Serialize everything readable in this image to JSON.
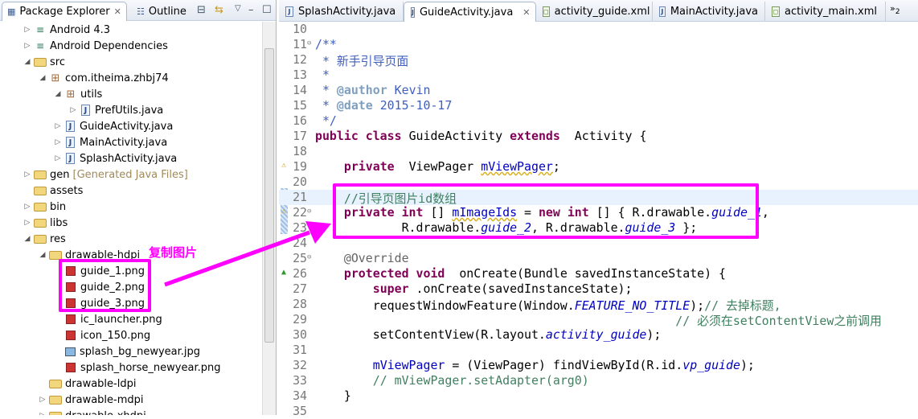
{
  "left_tabs": {
    "package_explorer": "Package Explorer",
    "outline": "Outline"
  },
  "tree": [
    {
      "label": "Android 4.3",
      "level": 0,
      "toggle": "collapsed",
      "icon": "lib"
    },
    {
      "label": "Android Dependencies",
      "level": 0,
      "toggle": "collapsed",
      "icon": "lib"
    },
    {
      "label": "src",
      "level": 0,
      "toggle": "expanded",
      "icon": "folder"
    },
    {
      "label": "com.itheima.zhbj74",
      "level": 1,
      "toggle": "expanded",
      "icon": "pkg"
    },
    {
      "label": "utils",
      "level": 2,
      "toggle": "expanded",
      "icon": "pkg"
    },
    {
      "label": "PrefUtils.java",
      "level": 3,
      "toggle": "collapsed",
      "icon": "java"
    },
    {
      "label": "GuideActivity.java",
      "level": 2,
      "toggle": "collapsed",
      "icon": "java"
    },
    {
      "label": "MainActivity.java",
      "level": 2,
      "toggle": "collapsed",
      "icon": "java"
    },
    {
      "label": "SplashActivity.java",
      "level": 2,
      "toggle": "collapsed",
      "icon": "java"
    },
    {
      "label": "gen",
      "decor": "[Generated Java Files]",
      "level": 0,
      "toggle": "collapsed",
      "icon": "folder"
    },
    {
      "label": "assets",
      "level": 0,
      "toggle": "none",
      "icon": "folder"
    },
    {
      "label": "bin",
      "level": 0,
      "toggle": "collapsed",
      "icon": "folder"
    },
    {
      "label": "libs",
      "level": 0,
      "toggle": "collapsed",
      "icon": "folder"
    },
    {
      "label": "res",
      "level": 0,
      "toggle": "expanded",
      "icon": "folder"
    },
    {
      "label": "drawable-hdpi",
      "level": 1,
      "toggle": "expanded",
      "icon": "folder"
    },
    {
      "label": "guide_1.png",
      "level": 2,
      "toggle": "none",
      "icon": "png"
    },
    {
      "label": "guide_2.png",
      "level": 2,
      "toggle": "none",
      "icon": "png"
    },
    {
      "label": "guide_3.png",
      "level": 2,
      "toggle": "none",
      "icon": "png"
    },
    {
      "label": "ic_launcher.png",
      "level": 2,
      "toggle": "none",
      "icon": "png"
    },
    {
      "label": "icon_150.png",
      "level": 2,
      "toggle": "none",
      "icon": "png"
    },
    {
      "label": "splash_bg_newyear.jpg",
      "level": 2,
      "toggle": "none",
      "icon": "jpg"
    },
    {
      "label": "splash_horse_newyear.png",
      "level": 2,
      "toggle": "none",
      "icon": "png"
    },
    {
      "label": "drawable-ldpi",
      "level": 1,
      "toggle": "none",
      "icon": "folder"
    },
    {
      "label": "drawable-mdpi",
      "level": 1,
      "toggle": "collapsed",
      "icon": "folder"
    },
    {
      "label": "drawable-xhdpi",
      "level": 1,
      "toggle": "collapsed",
      "icon": "folder"
    }
  ],
  "editor_tabs": [
    {
      "label": "SplashActivity.java",
      "type": "java",
      "active": false
    },
    {
      "label": "GuideActivity.java",
      "type": "java",
      "active": true
    },
    {
      "label": "activity_guide.xml",
      "type": "xml",
      "active": false
    },
    {
      "label": "MainActivity.java",
      "type": "java",
      "active": false
    },
    {
      "label": "activity_main.xml",
      "type": "xml",
      "active": false
    }
  ],
  "overflow_count": "2",
  "code": [
    {
      "n": "10",
      "tokens": []
    },
    {
      "n": "11",
      "fold": true,
      "tokens": [
        [
          "jd",
          "/**"
        ]
      ]
    },
    {
      "n": "12",
      "tokens": [
        [
          "jd",
          " * 新手引导页面"
        ]
      ]
    },
    {
      "n": "13",
      "tokens": [
        [
          "jd",
          " *"
        ]
      ]
    },
    {
      "n": "14",
      "tokens": [
        [
          "jd",
          " * "
        ],
        [
          "jt",
          "@author"
        ],
        [
          "jd",
          " Kevin"
        ]
      ]
    },
    {
      "n": "15",
      "tokens": [
        [
          "jd",
          " * "
        ],
        [
          "jt",
          "@date"
        ],
        [
          "jd",
          " 2015-10-17"
        ]
      ]
    },
    {
      "n": "16",
      "tokens": [
        [
          "jd",
          " */"
        ]
      ]
    },
    {
      "n": "17",
      "tokens": [
        [
          "kw",
          "public class"
        ],
        [
          "",
          "GuideActivity "
        ],
        [
          "kw",
          "extends"
        ],
        [
          "",
          " Activity {"
        ]
      ]
    },
    {
      "n": "18",
      "tokens": []
    },
    {
      "n": "19",
      "mark": "warn",
      "tokens": [
        [
          "",
          "    "
        ],
        [
          "kw",
          "private"
        ],
        [
          "",
          " ViewPager "
        ],
        [
          "var sq",
          "mViewPager"
        ],
        [
          "",
          ";"
        ]
      ]
    },
    {
      "n": "20",
      "tokens": []
    },
    {
      "n": "21",
      "cur": true,
      "tokens": [
        [
          "",
          "    "
        ],
        [
          "cm",
          "//引导页图片id数组"
        ]
      ]
    },
    {
      "n": "22",
      "mark": "warn",
      "fold": true,
      "tokens": [
        [
          "",
          "    "
        ],
        [
          "kw",
          "private int"
        ],
        [
          "",
          "[] "
        ],
        [
          "var sq",
          "mImageIds"
        ],
        [
          "",
          " = "
        ],
        [
          "kw",
          "new int"
        ],
        [
          "",
          "[] { R.drawable."
        ],
        [
          "fld",
          "guide_1"
        ],
        [
          "",
          ","
        ]
      ]
    },
    {
      "n": "23",
      "tokens": [
        [
          "",
          "            R.drawable."
        ],
        [
          "fld",
          "guide_2"
        ],
        [
          "",
          ", R.drawable."
        ],
        [
          "fld",
          "guide_3"
        ],
        [
          "",
          " };"
        ]
      ]
    },
    {
      "n": "24",
      "tokens": []
    },
    {
      "n": "25",
      "fold": true,
      "tokens": [
        [
          "",
          "    "
        ],
        [
          "ann",
          "@Override"
        ]
      ]
    },
    {
      "n": "26",
      "mark": "override",
      "tokens": [
        [
          "",
          "    "
        ],
        [
          "kw",
          "protected void"
        ],
        [
          "",
          " onCreate(Bundle savedInstanceState) {"
        ]
      ]
    },
    {
      "n": "27",
      "tokens": [
        [
          "",
          "        "
        ],
        [
          "kw",
          "super"
        ],
        [
          "",
          ".onCreate(savedInstanceState);"
        ]
      ]
    },
    {
      "n": "28",
      "tokens": [
        [
          "",
          "        requestWindowFeature(Window."
        ],
        [
          "fld",
          "FEATURE_NO_TITLE"
        ],
        [
          "",
          ");"
        ],
        [
          "cm",
          "// 去掉标题,"
        ]
      ]
    },
    {
      "n": "29",
      "tokens": [
        [
          "",
          "                                                  "
        ],
        [
          "cm",
          "// 必须在setContentView之前调用"
        ]
      ]
    },
    {
      "n": "30",
      "tokens": [
        [
          "",
          "        setContentView(R.layout."
        ],
        [
          "fld",
          "activity_guide"
        ],
        [
          "",
          ");"
        ]
      ]
    },
    {
      "n": "31",
      "tokens": []
    },
    {
      "n": "32",
      "tokens": [
        [
          "",
          "        "
        ],
        [
          "var",
          "mViewPager"
        ],
        [
          "",
          " = (ViewPager) findViewById(R.id."
        ],
        [
          "fld",
          "vp_guide"
        ],
        [
          "",
          ");"
        ]
      ]
    },
    {
      "n": "33",
      "tokens": [
        [
          "",
          "        "
        ],
        [
          "cm",
          "// mViewPager.setAdapter(arg0)"
        ]
      ]
    },
    {
      "n": "34",
      "tokens": [
        [
          "",
          "    }"
        ]
      ]
    },
    {
      "n": "35",
      "tokens": []
    }
  ],
  "annotation": {
    "label": "复制图片",
    "color": "#ff00ff"
  }
}
